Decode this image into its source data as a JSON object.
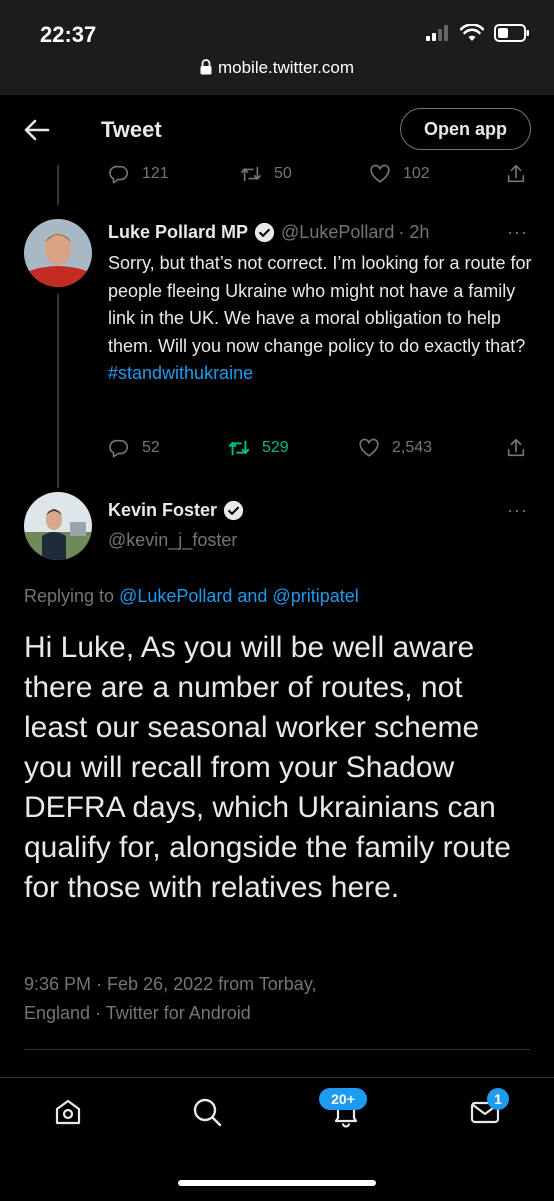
{
  "status_bar": {
    "time": "22:37",
    "url": "mobile.twitter.com"
  },
  "header": {
    "title": "Tweet",
    "open_app": "Open app"
  },
  "prev_actions": {
    "replies": "121",
    "retweets": "50",
    "likes": "102"
  },
  "reply": {
    "name": "Luke Pollard MP",
    "handle": "@LukePollard",
    "time": "· 2h",
    "more": "···",
    "text": "Sorry, but that’s not correct. I’m looking for a route for people fleeing Ukraine who might not have a family link in the UK. We have a moral obligation to help them. Will you now change policy to do exactly that?",
    "hashtag": "#standwithukraine",
    "replies": "52",
    "retweets": "529",
    "likes": "2,543"
  },
  "main": {
    "name": "Kevin Foster",
    "handle": "@kevin_j_foster",
    "more": "···",
    "replying_prefix": "Replying to",
    "replying_to": "@LukePollard and @pritipatel",
    "text": "Hi Luke, As you will be well aware there are a number of routes, not least our seasonal worker scheme you will recall from your Shadow DEFRA days, which Ukrainians can qualify for, alongside the family route for those with relatives here.",
    "meta_line1": "9:36 PM · Feb 26, 2022 from Torbay,",
    "meta_line2": "England · Twitter for Android"
  },
  "bottom_nav": {
    "notifications_badge": "20+",
    "messages_badge": "1"
  },
  "colors": {
    "accent": "#1d9bf0",
    "retweet_active": "#00ba7c",
    "muted": "#71767b",
    "background": "#000000"
  },
  "icons": [
    "lock-icon",
    "back-arrow-icon",
    "reply-icon",
    "retweet-icon",
    "like-icon",
    "share-icon",
    "verified-badge-icon",
    "home-icon",
    "search-icon",
    "notifications-icon",
    "messages-icon"
  ]
}
